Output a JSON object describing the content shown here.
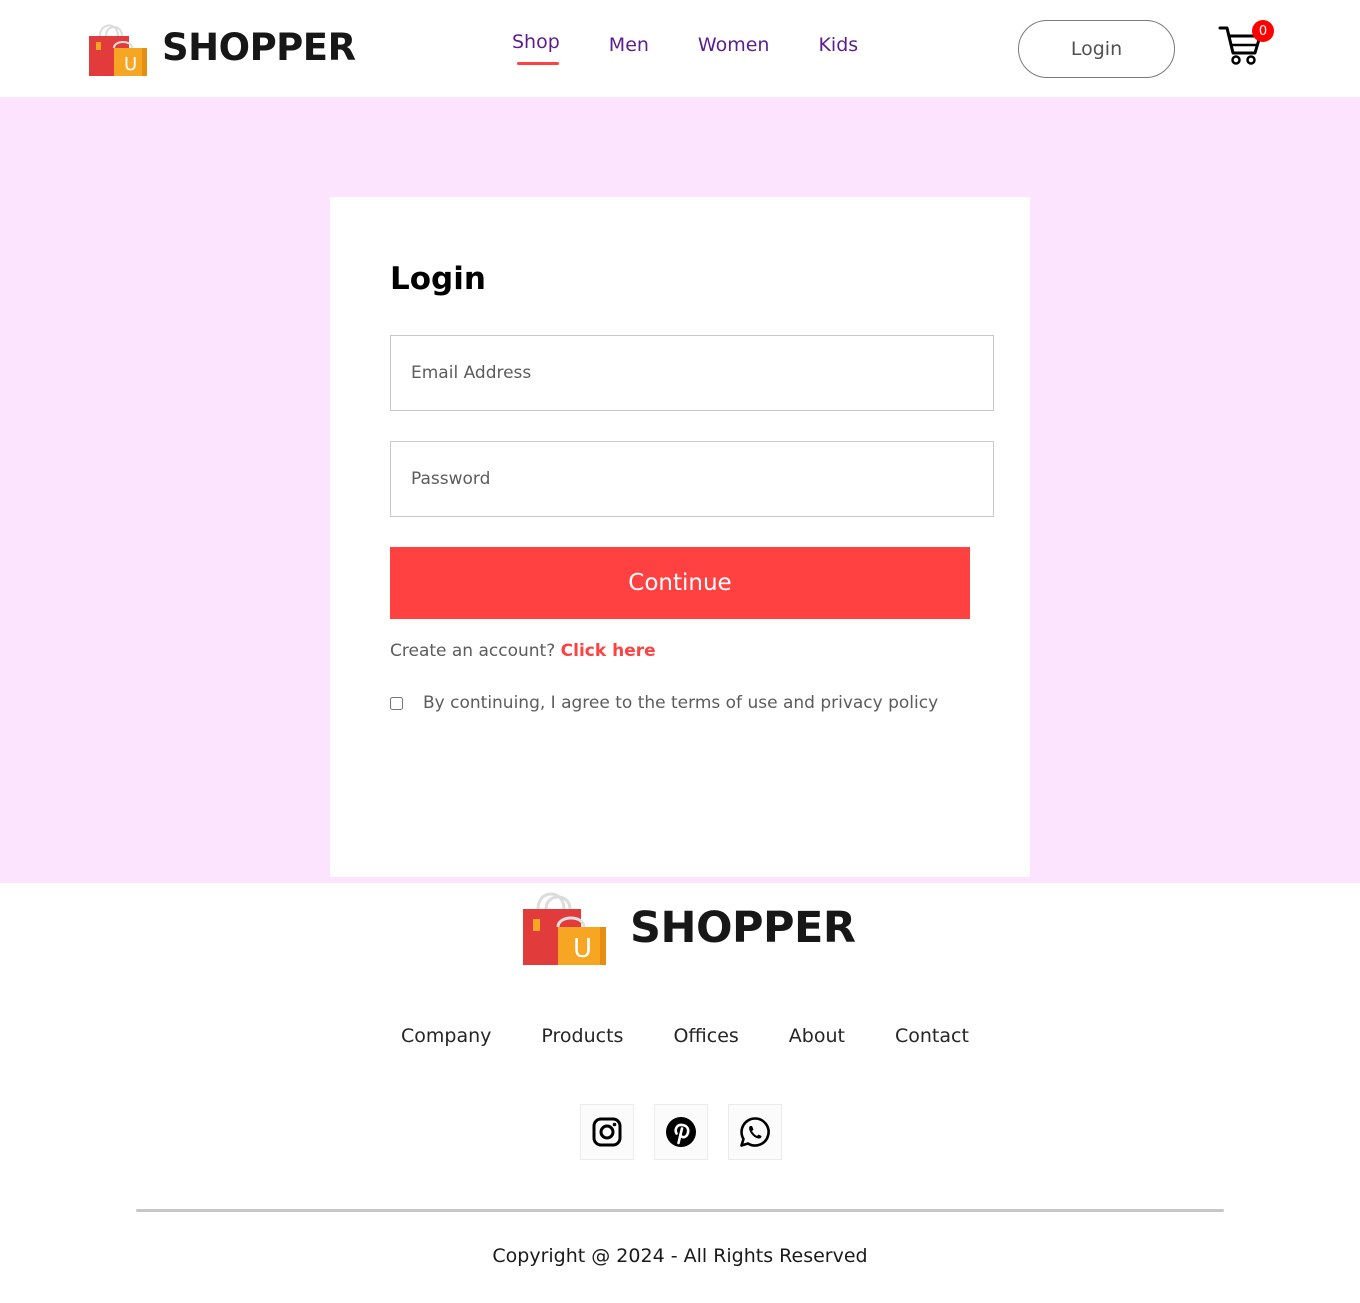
{
  "navbar": {
    "logo_text": "SHOPPER",
    "menu": [
      {
        "label": "Shop",
        "active": true
      },
      {
        "label": "Men",
        "active": false
      },
      {
        "label": "Women",
        "active": false
      },
      {
        "label": "Kids",
        "active": false
      }
    ],
    "login_button": "Login",
    "cart_count": "0"
  },
  "login": {
    "title": "Login",
    "email_placeholder": "Email Address",
    "password_placeholder": "Password",
    "continue_button": "Continue",
    "create_account_prompt": "Create an account?",
    "create_account_link": "Click here",
    "agree_text": "By continuing, I agree to the terms of use and privacy policy",
    "agree_checked": false
  },
  "footer": {
    "logo_text": "SHOPPER",
    "links": [
      "Company",
      "Products",
      "Offices",
      "About",
      "Contact"
    ],
    "social": [
      "instagram-icon",
      "pinterest-icon",
      "whatsapp-icon"
    ],
    "copyright": "Copyright @ 2024 - All Rights Reserved"
  },
  "colors": {
    "accent": "#ff4141",
    "nav_text": "#5c1e8f",
    "section_bg": "#fce3fe"
  }
}
